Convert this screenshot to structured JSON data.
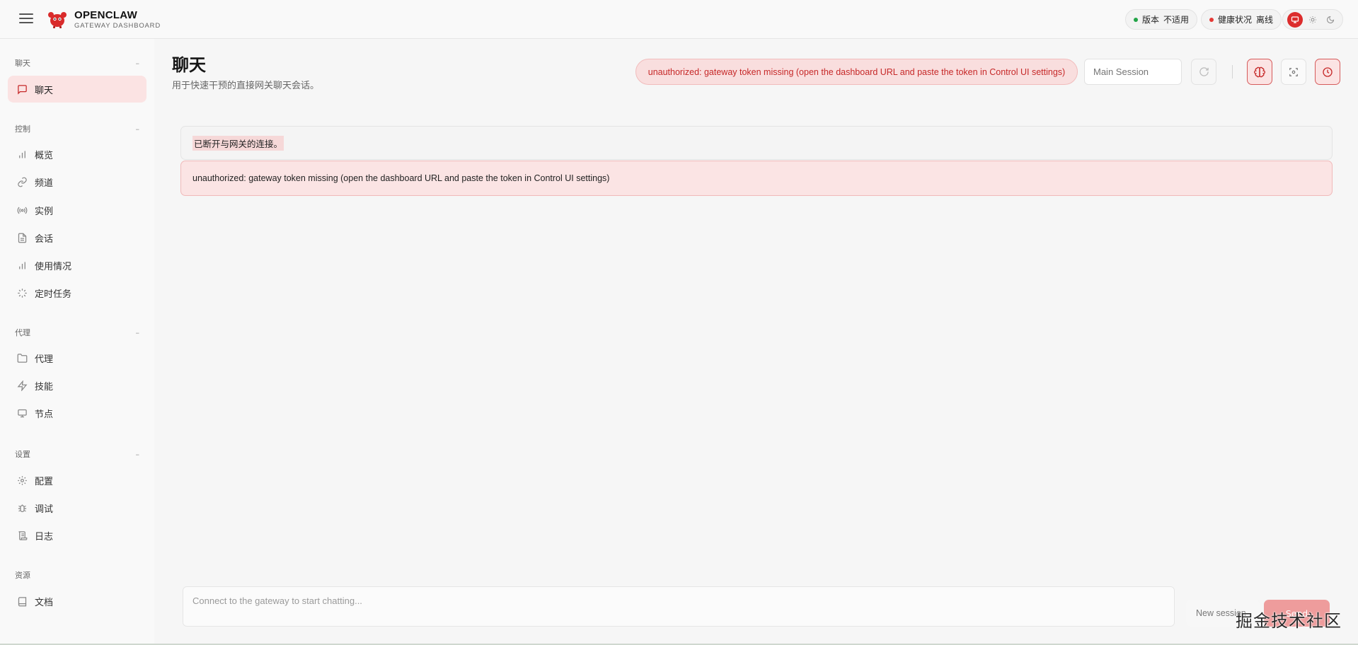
{
  "header": {
    "brand_title": "OPENCLAW",
    "brand_subtitle": "GATEWAY DASHBOARD",
    "version": {
      "label": "版本",
      "value": "不适用",
      "status_color": "#22a447"
    },
    "health": {
      "label": "健康状况",
      "value": "离线",
      "status_color": "#e53935"
    },
    "theme_modes": [
      "monitor-icon",
      "sun-icon",
      "moon-icon"
    ],
    "active_theme": "monitor-icon"
  },
  "sidebar": {
    "sections": [
      {
        "label": "聊天",
        "items": [
          {
            "label": "聊天",
            "icon": "message-icon",
            "active": true
          }
        ]
      },
      {
        "label": "控制",
        "items": [
          {
            "label": "概览",
            "icon": "bar-chart-icon"
          },
          {
            "label": "频道",
            "icon": "link-icon"
          },
          {
            "label": "实例",
            "icon": "radio-icon"
          },
          {
            "label": "会话",
            "icon": "file-icon"
          },
          {
            "label": "使用情况",
            "icon": "bar-chart-icon"
          },
          {
            "label": "定时任务",
            "icon": "loader-icon"
          }
        ]
      },
      {
        "label": "代理",
        "items": [
          {
            "label": "代理",
            "icon": "folder-icon"
          },
          {
            "label": "技能",
            "icon": "zap-icon"
          },
          {
            "label": "节点",
            "icon": "monitor-icon"
          }
        ]
      },
      {
        "label": "设置",
        "items": [
          {
            "label": "配置",
            "icon": "gear-icon"
          },
          {
            "label": "调试",
            "icon": "bug-icon"
          },
          {
            "label": "日志",
            "icon": "scroll-icon"
          }
        ]
      },
      {
        "label": "资源",
        "items": [
          {
            "label": "文档",
            "icon": "book-icon"
          }
        ]
      }
    ],
    "collapse_glyph": "–"
  },
  "main": {
    "title": "聊天",
    "subtitle": "用于快速干预的直接网关聊天会话。",
    "error_banner": "unauthorized: gateway token missing (open the dashboard URL and paste the token in Control UI settings)",
    "session_placeholder": "Main Session",
    "messages": [
      {
        "type": "plain",
        "text": "已断开与网关的连接。"
      },
      {
        "type": "error",
        "text": "unauthorized: gateway token missing (open the dashboard URL and paste the token in Control UI settings)"
      }
    ],
    "composer_placeholder": "Connect to the gateway to start chatting...",
    "new_session_label": "New session",
    "send_label": "Send"
  },
  "watermark": "掘金技术社区",
  "colors": {
    "accent": "#dc2c2c",
    "active_nav_bg": "#fbe3e3",
    "error_bg": "#fbe4e4",
    "error_text": "#c62828"
  }
}
